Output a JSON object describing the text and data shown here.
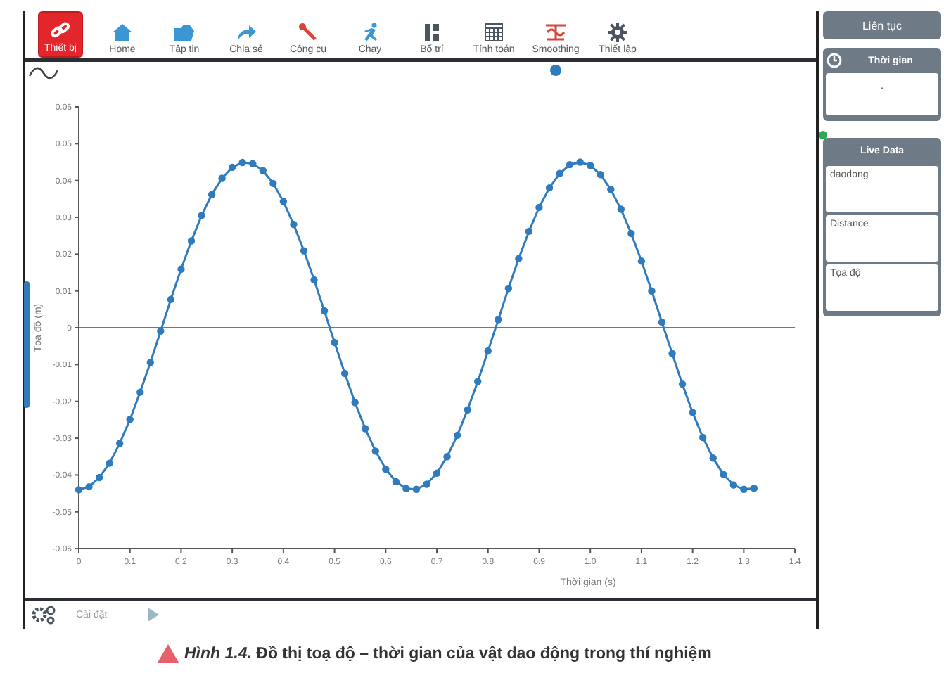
{
  "toolbar": [
    {
      "label": "Thiết bị",
      "kind": "link",
      "selected": true
    },
    {
      "label": "Home",
      "kind": "home",
      "selected": false
    },
    {
      "label": "Tập tin",
      "kind": "folder",
      "selected": false
    },
    {
      "label": "Chia sẻ",
      "kind": "share",
      "selected": false
    },
    {
      "label": "Công cụ",
      "kind": "wrench",
      "selected": false
    },
    {
      "label": "Chạy",
      "kind": "run",
      "selected": false
    },
    {
      "label": "Bố trí",
      "kind": "layout",
      "selected": false
    },
    {
      "label": "Tính toán",
      "kind": "calc",
      "selected": false
    },
    {
      "label": "Smoothing",
      "kind": "smooth",
      "selected": false
    },
    {
      "label": "Thiết lập",
      "kind": "gear",
      "selected": false
    }
  ],
  "chart": {
    "chart_data": {
      "type": "line",
      "xlabel": "Thời gian (s)",
      "ylabel": "Tọa độ (m)",
      "xlim": [
        0,
        1.4
      ],
      "ylim": [
        -0.06,
        0.06
      ],
      "xticks": [
        {
          "value": 0,
          "label": "0"
        },
        {
          "value": 0.1,
          "label": "0.1"
        },
        {
          "value": 0.2,
          "label": "0.2"
        },
        {
          "value": 0.3,
          "label": "0.3"
        },
        {
          "value": 0.4,
          "label": "0.4"
        },
        {
          "value": 0.5,
          "label": "0.5"
        },
        {
          "value": 0.6,
          "label": "0.6"
        },
        {
          "value": 0.7,
          "label": "0.7"
        },
        {
          "value": 0.8,
          "label": "0.8"
        },
        {
          "value": 0.9,
          "label": "0.9"
        },
        {
          "value": 1.0,
          "label": "1.0"
        },
        {
          "value": 1.1,
          "label": "1.1"
        },
        {
          "value": 1.2,
          "label": "1.2"
        },
        {
          "value": 1.3,
          "label": "1.3"
        },
        {
          "value": 1.4,
          "label": "1.4"
        }
      ],
      "yticks": [
        {
          "value": 0.06,
          "label": "0.06"
        },
        {
          "value": 0.05,
          "label": "0.05"
        },
        {
          "value": 0.04,
          "label": "0.04"
        },
        {
          "value": 0.03,
          "label": "0.03"
        },
        {
          "value": 0.02,
          "label": "0.02"
        },
        {
          "value": 0.01,
          "label": "0.01"
        },
        {
          "value": 0,
          "label": "0"
        },
        {
          "value": -0.01,
          "label": "-0.01"
        },
        {
          "value": -0.02,
          "label": "-0.02"
        },
        {
          "value": -0.03,
          "label": "-0.03"
        },
        {
          "value": -0.04,
          "label": "-0.04"
        },
        {
          "value": -0.05,
          "label": "-0.05"
        },
        {
          "value": -0.06,
          "label": "-0.06"
        }
      ],
      "x": [
        0,
        0.02,
        0.04,
        0.06,
        0.08,
        0.1,
        0.12,
        0.14,
        0.16,
        0.18,
        0.2,
        0.22,
        0.24,
        0.26,
        0.28,
        0.3,
        0.32,
        0.34,
        0.36,
        0.38,
        0.4,
        0.42,
        0.44,
        0.46,
        0.48,
        0.5,
        0.52,
        0.54,
        0.56,
        0.58,
        0.6,
        0.62,
        0.64,
        0.66,
        0.68,
        0.7,
        0.72,
        0.74,
        0.76,
        0.78,
        0.8,
        0.82,
        0.84,
        0.86,
        0.88,
        0.9,
        0.92,
        0.94,
        0.96,
        0.98,
        1.0,
        1.02,
        1.04,
        1.06,
        1.08,
        1.1,
        1.12,
        1.14,
        1.16,
        1.18,
        1.2,
        1.22,
        1.24,
        1.26,
        1.28,
        1.3,
        1.32
      ],
      "series": [
        {
          "color": "#2f7bbd",
          "marker": "circle",
          "values": [
            -0.044,
            -0.0432,
            -0.0407,
            -0.0368,
            -0.0314,
            -0.0249,
            -0.0175,
            -0.0094,
            -0.0009,
            0.0077,
            0.0159,
            0.0236,
            0.0305,
            0.0362,
            0.0406,
            0.0436,
            0.0449,
            0.0446,
            0.0427,
            0.0392,
            0.0343,
            0.0281,
            0.0209,
            0.013,
            0.0046,
            -0.004,
            -0.0124,
            -0.0203,
            -0.0274,
            -0.0335,
            -0.0384,
            -0.0418,
            -0.0437,
            -0.0439,
            -0.0425,
            -0.0395,
            -0.035,
            -0.0292,
            -0.0223,
            -0.0146,
            -0.0063,
            0.0022,
            0.0107,
            0.0188,
            0.0262,
            0.0327,
            0.038,
            0.0419,
            0.0443,
            0.045,
            0.0441,
            0.0416,
            0.0376,
            0.0322,
            0.0256,
            0.0181,
            0.01,
            0.0015,
            -0.007,
            -0.0153,
            -0.023,
            -0.0298,
            -0.0354,
            -0.0398,
            -0.0427,
            -0.0439,
            -0.0436
          ]
        }
      ]
    }
  },
  "bottom_bar": {
    "settings_label": "Cài đặt"
  },
  "side_panel": {
    "mode_button": "Liên tục",
    "timer": {
      "title": "Thời gian",
      "value": "."
    },
    "live_data": {
      "title": "Live Data",
      "sensors": [
        "daodong",
        "Distance",
        "Tọa độ"
      ]
    }
  },
  "caption": {
    "text": "*Hình 1.4.* Đồ thị toạ độ – thời gian của vật dao động trong thí nghiệm"
  }
}
